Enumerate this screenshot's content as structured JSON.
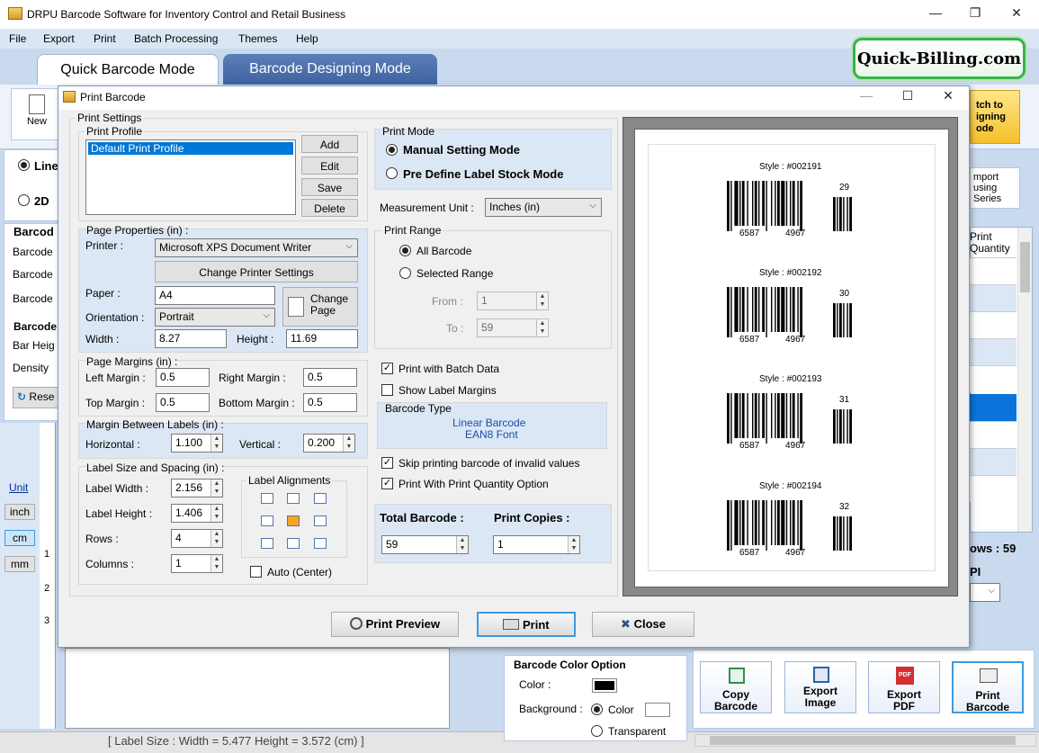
{
  "app": {
    "title": "DRPU Barcode Software for Inventory Control and Retail Business",
    "menu": [
      "File",
      "Export",
      "Print",
      "Batch Processing",
      "Themes",
      "Help"
    ],
    "tabs": [
      "Quick Barcode Mode",
      "Barcode Designing Mode"
    ],
    "brand": "Quick-Billing.com",
    "toolbar_new": "New",
    "switch_btn": [
      "tch to",
      "igning",
      "ode"
    ],
    "import_btn": [
      "mport",
      "using",
      "Series"
    ],
    "left_partial": [
      "Line",
      "2D",
      "Barcod",
      "Barcode",
      "Barcode",
      "Barcode",
      "Barcode",
      "Bar Heig",
      "Density",
      "Rese"
    ],
    "units": {
      "label": "Unit",
      "items": [
        "inch",
        "cm",
        "mm"
      ]
    },
    "ruler": [
      "1",
      "2",
      "3"
    ],
    "right_col": {
      "header": [
        "Print",
        "Quantity"
      ],
      "rows_label": "ows : 59",
      "dpi": "PI"
    },
    "status": "[ Label Size : Width = 5.477  Height = 3.572 (cm) ]",
    "color_option": {
      "title": "Barcode Color Option",
      "color": "Color :",
      "background": "Background :",
      "bg_color": "Color",
      "bg_transparent": "Transparent"
    },
    "bottom_buttons": [
      [
        "Copy",
        "Barcode"
      ],
      [
        "Export",
        "Image"
      ],
      [
        "Export",
        "PDF"
      ],
      [
        "Print",
        "Barcode"
      ]
    ]
  },
  "dialog": {
    "title": "Print Barcode",
    "print_settings": "Print Settings",
    "print_profile": {
      "label": "Print Profile",
      "items": [
        "Default Print Profile"
      ],
      "buttons": [
        "Add",
        "Edit",
        "Save",
        "Delete"
      ]
    },
    "page_properties": {
      "label": "Page Properties (in) :",
      "printer_label": "Printer :",
      "printer": "Microsoft XPS Document Writer",
      "change_printer": "Change Printer Settings",
      "paper_label": "Paper :",
      "paper": "A4",
      "change_page": [
        "Change",
        "Page"
      ],
      "orientation_label": "Orientation :",
      "orientation": "Portrait",
      "width_label": "Width :",
      "width": "8.27",
      "height_label": "Height :",
      "height": "11.69"
    },
    "page_margins": {
      "label": "Page Margins (in) :",
      "left_label": "Left Margin :",
      "left": "0.5",
      "right_label": "Right Margin :",
      "right": "0.5",
      "top_label": "Top Margin :",
      "top": "0.5",
      "bottom_label": "Bottom Margin :",
      "bottom": "0.5"
    },
    "margin_between": {
      "label": "Margin Between Labels (in) :",
      "horizontal_label": "Horizontal :",
      "horizontal": "1.100",
      "vertical_label": "Vertical :",
      "vertical": "0.200"
    },
    "label_size": {
      "label": "Label Size and Spacing (in) :",
      "width_label": "Label Width :",
      "width": "2.156",
      "height_label": "Label Height :",
      "height": "1.406",
      "rows_label": "Rows :",
      "rows": "4",
      "columns_label": "Columns :",
      "columns": "1",
      "alignments": "Label Alignments",
      "auto": "Auto (Center)"
    },
    "print_mode": {
      "label": "Print Mode",
      "manual": "Manual Setting Mode",
      "predefine": "Pre Define Label Stock Mode"
    },
    "measurement": {
      "label": "Measurement Unit :",
      "value": "Inches (in)"
    },
    "print_range": {
      "label": "Print Range",
      "all": "All Barcode",
      "selected": "Selected Range",
      "from_label": "From :",
      "from": "1",
      "to_label": "To :",
      "to": "59"
    },
    "options": {
      "batch": "Print with Batch Data",
      "margins": "Show Label Margins",
      "skip": "Skip printing barcode of invalid values",
      "quantity": "Print With Print Quantity Option"
    },
    "barcode_type": {
      "label": "Barcode Type",
      "line1": "Linear Barcode",
      "line2": "EAN8 Font"
    },
    "totals": {
      "total_label": "Total Barcode :",
      "total": "59",
      "copies_label": "Print Copies :",
      "copies": "1"
    },
    "buttons": {
      "preview": "Print Preview",
      "print": "Print",
      "close": "Close"
    },
    "barcodes": [
      {
        "style": "Style : #002191",
        "left": "6587",
        "right": "4967",
        "add": "29"
      },
      {
        "style": "Style : #002192",
        "left": "6587",
        "right": "4967",
        "add": "30"
      },
      {
        "style": "Style : #002193",
        "left": "6587",
        "right": "4967",
        "add": "31"
      },
      {
        "style": "Style : #002194",
        "left": "6587",
        "right": "4967",
        "add": "32"
      }
    ]
  },
  "colors": {
    "accent": "#3e9ae0",
    "tab_active": "#ffffff",
    "tab_inactive": "#4a6fab",
    "brand_border": "#37b34a",
    "panel_blue": "#dce7f5"
  }
}
